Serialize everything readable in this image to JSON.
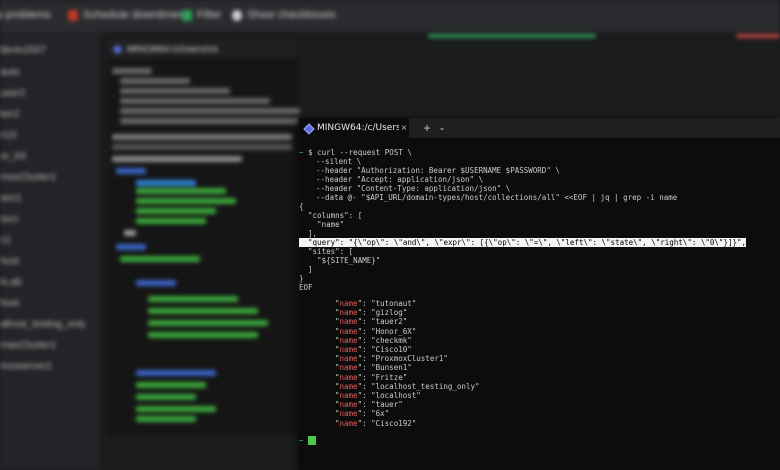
{
  "toolbar": {
    "items": [
      {
        "label": "lp problems",
        "icon": "alert-icon"
      },
      {
        "label": "Schedule downtimes",
        "icon": "calendar-icon"
      },
      {
        "label": "Filter",
        "icon": "filter-icon"
      },
      {
        "label": "Show checkboxes",
        "icon": "eye-icon"
      }
    ],
    "colors": {
      "red": "#c0392b",
      "green": "#2e9d57",
      "neutral": "#cfcfcf"
    }
  },
  "sidebar": {
    "rows": [
      "ble4v2007",
      "auto",
      "user2",
      "ker2",
      "n10",
      "or_6X",
      "moxCluster1",
      "sen1",
      "tze1",
      "n1",
      "host",
      "lo.ab",
      "host",
      "alhost_testing_only",
      "maxCluster1",
      "moxserver1"
    ]
  },
  "background_terminal": {
    "tab_title": "MINGW64:/c/Users/Us"
  },
  "terminal": {
    "tab_title": "MINGW64:/c/Users/Use",
    "tab_close": "×",
    "new_tab": "+",
    "dropdown": "⌄",
    "prompt_symbol": "~",
    "command_lines": [
      "$ curl --request POST \\",
      "  --silent \\",
      "  --header \"Authorization: Bearer $USERNAME $PASSWORD\" \\",
      "  --header \"Accept: application/json\" \\",
      "  --header \"Content-Type: application/json\" \\",
      "  --data @- \"$API_URL/domain-types/host/collections/all\" <<EOF | jq | grep -i name"
    ],
    "body_lines": [
      "{",
      "  \"columns\": [",
      "    \"name\"",
      "  ],"
    ],
    "query_line": "  \"query\": \"{\\\"op\\\": \\\"and\\\", \\\"expr\\\": [{\\\"op\\\": \\\"=\\\", \\\"left\\\": \\\"state\\\", \\\"right\\\": \\\"0\\\"}]}\",",
    "tail_lines": [
      "  \"sites\": [",
      "    \"${SITE_NAME}\"",
      "  ]",
      "}",
      "EOF"
    ],
    "result_key": "\"name\"",
    "results": [
      "\"tutonaut\"",
      "\"gizlog\"",
      "\"tauer2\"",
      "\"Honor_6X\"",
      "\"checkmk\"",
      "\"Cisco10\"",
      "\"ProxmoxCluster1\"",
      "\"Bunsen1\"",
      "\"Fritze\"",
      "\"localhost_testing_only\"",
      "\"localhost\"",
      "\"tauer\"",
      "\"6x\"",
      "\"Cisco192\""
    ]
  }
}
